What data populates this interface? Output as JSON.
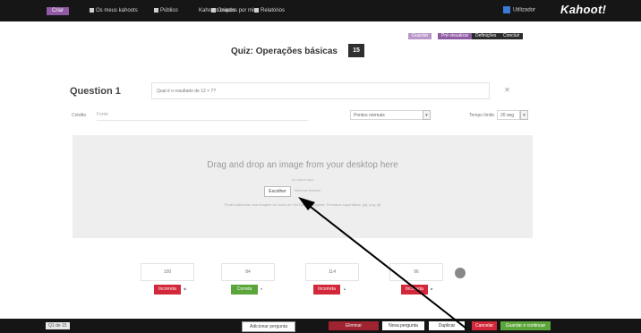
{
  "topbar": {
    "create": "Criar",
    "links": [
      "Os meus kahoots",
      "Público",
      "Kahoots criados por mim",
      "Grupos",
      "Relatórios"
    ],
    "user": "Utilizador",
    "logo": "Kahoot!"
  },
  "toolbar": {
    "buttons": [
      "Guardar",
      "Pré-visualizar",
      "Definições",
      "Concluir"
    ]
  },
  "quiz": {
    "title": "Quiz: Operações básicas",
    "count": "15"
  },
  "question": {
    "label": "Question 1",
    "text": "Qual é o resultado de 12 × 7?",
    "credit_label": "Crédito",
    "credit_placeholder": "Fonte",
    "points": "Pontos normais",
    "time_label": "Tempo limite",
    "time_value": "20 seg"
  },
  "media": {
    "title": "Drag and drop an image from your desktop here",
    "or": "ou clique aqui",
    "browse": "Escolher",
    "none": "Nenhum ficheiro",
    "note": "Podes adicionar uma imagem ou vídeo do YouTube à pergunta. Formatos suportados: jpg, png, gif"
  },
  "answers": [
    {
      "text": "100",
      "status": "Incorreta",
      "color": "#d3283a"
    },
    {
      "text": "84",
      "status": "Correta",
      "color": "#5ba53b"
    },
    {
      "text": "114",
      "status": "Incorreta",
      "color": "#d3283a"
    },
    {
      "text": "96",
      "status": "Incorreta",
      "color": "#d3283a"
    }
  ],
  "bottombar": {
    "nav": "Q1 de 15",
    "buttons": [
      "Adicionar pergunta",
      "Eliminar",
      "Nova pergunta",
      "Duplicar",
      "Cancelar",
      "Guardar e continuar"
    ]
  }
}
